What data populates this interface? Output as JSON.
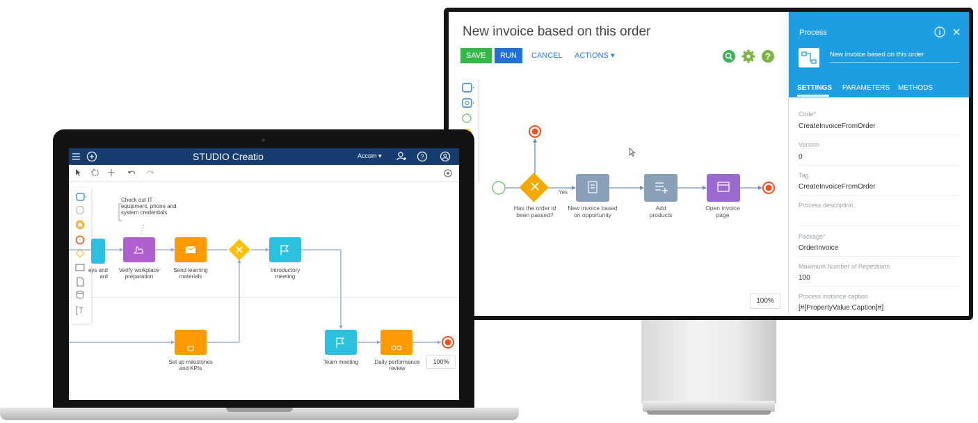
{
  "monitor": {
    "title": "New invoice based on this order",
    "toolbar": {
      "save": "SAVE",
      "run": "RUN",
      "cancel": "CANCEL",
      "actions": "ACTIONS ▾"
    },
    "diagram": {
      "yes_label": "Yes",
      "nodes": [
        {
          "name": "gateway",
          "caption": "Has the order id\nbeen passed?",
          "color": "#f5a800"
        },
        {
          "name": "new-invoice",
          "caption": "New invoice based\non opportunity",
          "color": "#8aa0b8"
        },
        {
          "name": "add-products",
          "caption": "Add\nproducts",
          "color": "#8aa0b8"
        },
        {
          "name": "open-invoice",
          "caption": "Open invoice\npage",
          "color": "#9b6ad0"
        }
      ],
      "zoom": "100%"
    },
    "panel": {
      "header": "Process",
      "element_name": "New invoice based on this order",
      "tabs": [
        "SETTINGS",
        "PARAMETERS",
        "METHODS"
      ],
      "fields": [
        {
          "label": "Code*",
          "value": "CreateInvoiceFromOrder"
        },
        {
          "label": "Version",
          "value": "0"
        },
        {
          "label": "Tag",
          "value": "CreateInvoiceFromOrder"
        },
        {
          "label": "Process description",
          "value": ""
        },
        {
          "label": "Package*",
          "value": "OrderInvoice"
        },
        {
          "label": "Maximum Number of Repetitions",
          "value": "100"
        },
        {
          "label": "Process instance caption",
          "value": "[#[PropertyValue:Caption]#]"
        }
      ]
    }
  },
  "laptop": {
    "brand": "STUDIO Creatio",
    "user": "Accom ▾",
    "note": "Check out IT\nequipment, phone and\nsystem credentials",
    "nodes": [
      {
        "name": "keys-task",
        "caption": "eys and\nard",
        "color": "#2cc0e0"
      },
      {
        "name": "verify-workplace",
        "caption": "Verify workplace\npreparation",
        "color": "#b05fd0"
      },
      {
        "name": "send-learning",
        "caption": "Send learning\nmaterials",
        "color": "#ff9a00"
      },
      {
        "name": "introductory-meeting",
        "caption": "Introductory\nmeeting",
        "color": "#2cc0e0"
      },
      {
        "name": "milestones",
        "caption": "Set up milestones\nand KPIs",
        "color": "#ff9a00"
      },
      {
        "name": "team-meeting",
        "caption": "Team meeting",
        "color": "#2cc0e0"
      },
      {
        "name": "daily-performance",
        "caption": "Daily performance\nreview",
        "color": "#ff9a00"
      }
    ],
    "zoom": "100%"
  }
}
